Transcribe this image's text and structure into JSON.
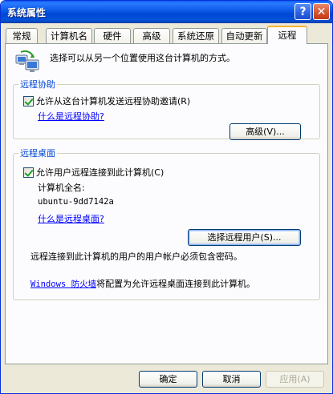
{
  "window": {
    "title": "系统属性",
    "help_glyph": "?",
    "close_glyph": "✕"
  },
  "tabs": [
    "常规",
    "计算机名",
    "硬件",
    "高级",
    "系统还原",
    "自动更新",
    "远程"
  ],
  "active_tab": "远程",
  "intro": {
    "icon": "remote-computer-icon",
    "text": "选择可以从另一个位置使用这台计算机的方式。"
  },
  "remote_assistance": {
    "legend": "远程协助",
    "checkbox_label": "允许从这台计算机发送远程协助邀请(R)",
    "checked": true,
    "link": "什么是远程协助?",
    "advanced_button": "高级(V)..."
  },
  "remote_desktop": {
    "legend": "远程桌面",
    "checkbox_label": "允许用户远程连接到此计算机(C)",
    "checked": true,
    "full_name_label": "计算机全名:",
    "full_name_value": "ubuntu-9dd7142a",
    "link": "什么是远程桌面?",
    "select_users_button": "选择远程用户(S)...",
    "password_note": "远程连接到此计算机的用户的用户帐户必须包含密码。",
    "firewall_link": "Windows 防火墙",
    "firewall_text": "将配置为允许远程桌面连接到此计算机。"
  },
  "footer": {
    "ok": "确定",
    "cancel": "取消",
    "apply": "应用(A)"
  },
  "colors": {
    "titlebar": "#0a58e6",
    "legend": "#0046d5",
    "link": "#0000ff",
    "active_tab_accent": "#f9b232"
  }
}
